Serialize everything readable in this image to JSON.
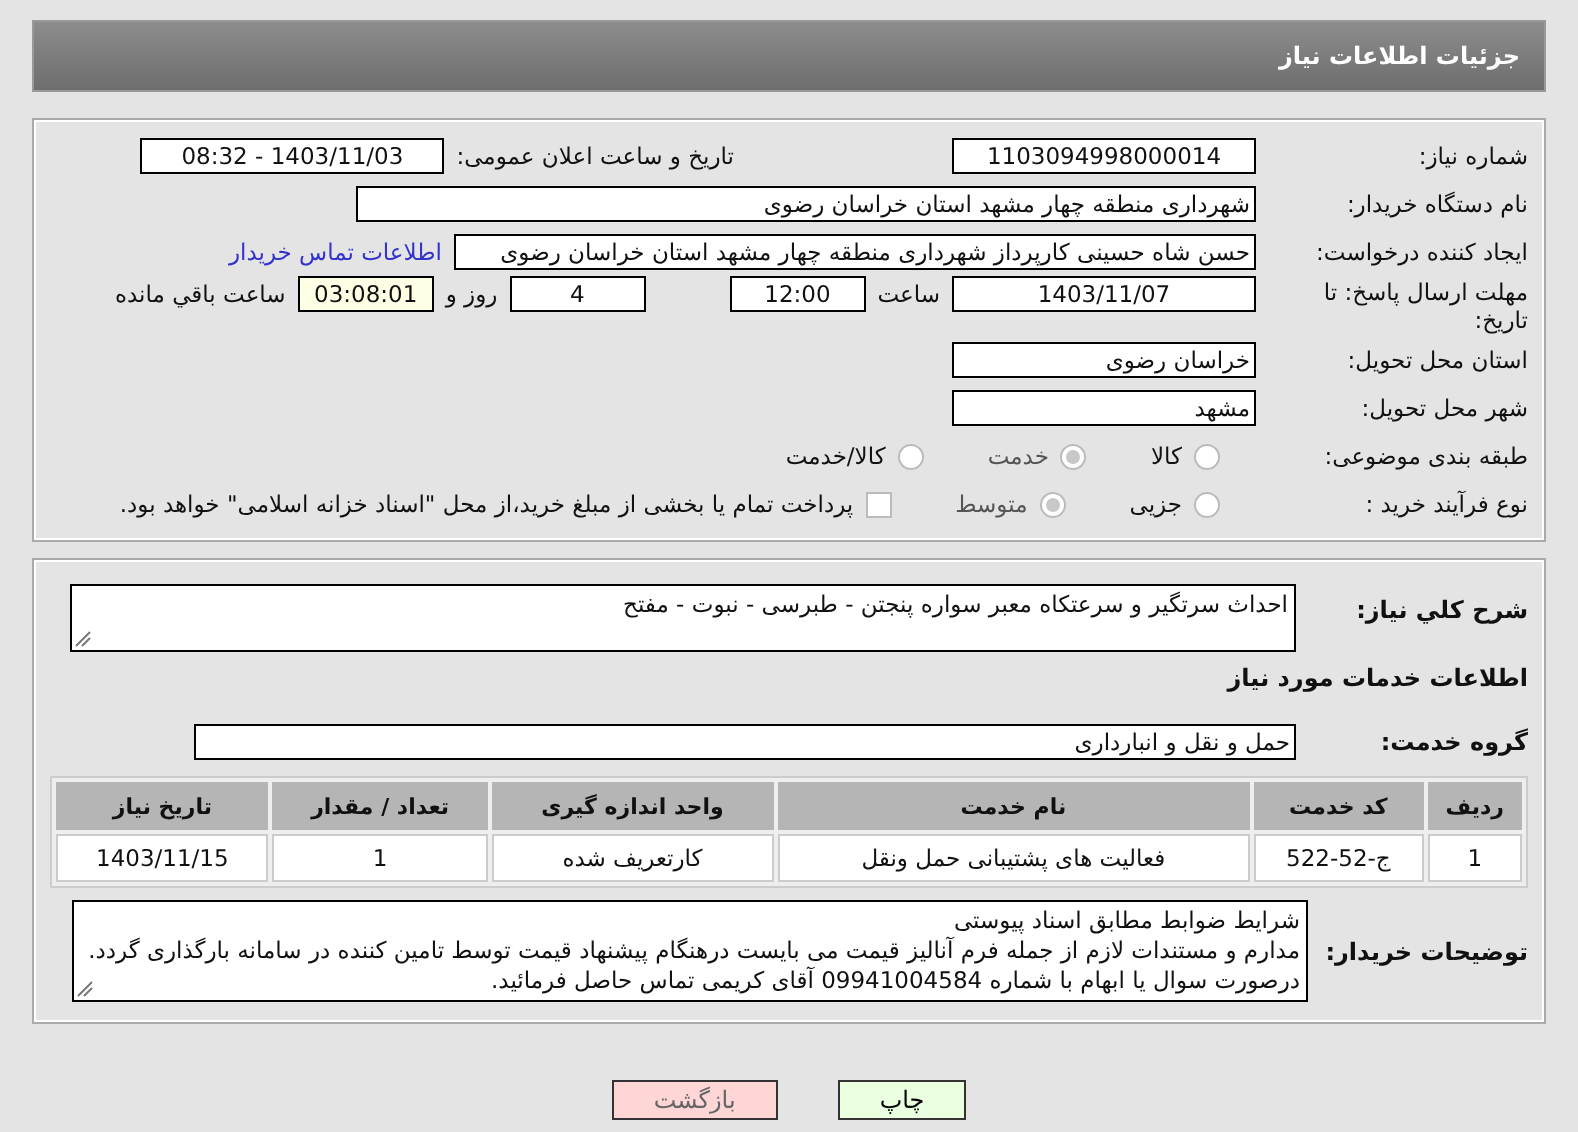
{
  "header": {
    "title": "جزئیات اطلاعات نیاز"
  },
  "details": {
    "need_number": {
      "label": "شماره نیاز:",
      "value": "1103094998000014"
    },
    "announce": {
      "label": "تاریخ و ساعت اعلان عمومی:",
      "value": "1403/11/03 - 08:32"
    },
    "buyer": {
      "label": "نام دستگاه خریدار:",
      "value": "شهرداری منطقه چهار مشهد استان خراسان رضوی"
    },
    "creator": {
      "label": "ایجاد کننده درخواست:",
      "value": "حسن شاه حسینی کارپرداز شهرداری منطقه چهار مشهد استان خراسان رضوی",
      "link": "اطلاعات تماس خریدار"
    },
    "deadline": {
      "label": "مهلت ارسال پاسخ: تا تاریخ:",
      "date": "1403/11/07",
      "time_label": "ساعت",
      "time": "12:00",
      "days": "4",
      "days_label": "روز و",
      "remaining": "03:08:01",
      "remaining_label": "ساعت باقي مانده"
    },
    "province": {
      "label": "استان محل تحویل:",
      "value": "خراسان رضوی"
    },
    "city": {
      "label": "شهر محل تحویل:",
      "value": "مشهد"
    },
    "category": {
      "label": "طبقه بندی موضوعی:",
      "options": [
        {
          "label": "کالا",
          "selected": false
        },
        {
          "label": "خدمت",
          "selected": true
        },
        {
          "label": "کالا/خدمت",
          "selected": false
        }
      ]
    },
    "process": {
      "label": "نوع فرآیند خرید :",
      "options": [
        {
          "label": "جزیی",
          "selected": false
        },
        {
          "label": "متوسط",
          "selected": true
        }
      ],
      "treasury": {
        "label": "پرداخت تمام یا بخشی از مبلغ خرید،از محل \"اسناد خزانه اسلامی\" خواهد بود.",
        "checked": false
      }
    }
  },
  "services": {
    "description": {
      "label": "شرح کلي نياز:",
      "value": "احداث سرتگیر و سرعتکاه معبر سواره پنجتن - طبرسی - نبوت - مفتح"
    },
    "heading": "اطلاعات خدمات مورد نیاز",
    "group": {
      "label": "گروه خدمت:",
      "value": "حمل و نقل و انبارداری"
    },
    "table": {
      "columns": [
        "ردیف",
        "کد خدمت",
        "نام خدمت",
        "واحد اندازه گیری",
        "تعداد / مقدار",
        "تاریخ نیاز"
      ],
      "rows": [
        [
          "1",
          "ج-52-522",
          "فعالیت های پشتیبانی حمل ونقل",
          "کارتعریف شده",
          "1",
          "1403/11/15"
        ]
      ]
    },
    "notes": {
      "label": "توضیحات خریدار:",
      "lines": [
        "شرایط ضوابط مطابق اسناد پیوستی",
        "مدارم و مستندات لازم از جمله فرم آنالیز قیمت می بایست درهنگام پیشنهاد قیمت توسط تامین کننده در سامانه بارگذاری گردد.",
        "درصورت سوال یا ابهام با شماره 09941004584 آقای کریمی تماس حاصل فرمائید."
      ]
    }
  },
  "buttons": [
    {
      "label": "چاپ",
      "kind": "print"
    },
    {
      "label": "بازگشت",
      "kind": "back"
    }
  ]
}
